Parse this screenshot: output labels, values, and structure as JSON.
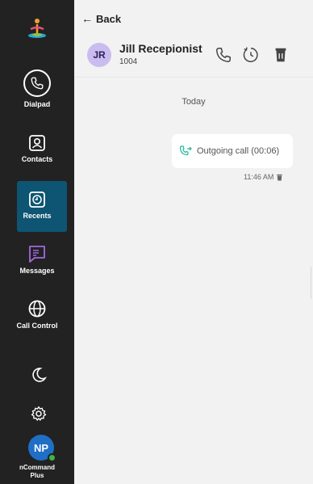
{
  "sidebar": {
    "nav": {
      "dialpad": "Dialpad",
      "contacts": "Contacts",
      "recents": "Recents",
      "messages": "Messages",
      "call_control": "Call Control"
    },
    "active_item": "Recents",
    "profile": {
      "initials": "NP",
      "name_line1": "nCommand",
      "name_line2": "Plus",
      "status": "online"
    }
  },
  "main": {
    "back_label": "Back",
    "contact": {
      "initials": "JR",
      "name": "Jill Recepionist",
      "extension": "1004"
    },
    "day_separator": "Today",
    "messages": [
      {
        "direction": "outgoing",
        "text": "Outgoing call (00:06)",
        "time": "11:46 AM"
      }
    ]
  },
  "colors": {
    "sidebar_bg": "#222222",
    "active_nav_bg": "#0d5572",
    "messages_icon": "#a368e0",
    "call_icon_green": "#1fb89a",
    "avatar_np": "#1f6fc7",
    "avatar_jr": "#cbbcef",
    "presence": "#3cb54a"
  },
  "icons": [
    "logo-icon",
    "phone-icon",
    "contacts-icon",
    "clock-icon",
    "messages-icon",
    "globe-icon",
    "moon-icon",
    "gear-icon",
    "back-arrow-icon",
    "history-icon",
    "trash-icon",
    "outgoing-call-icon"
  ]
}
